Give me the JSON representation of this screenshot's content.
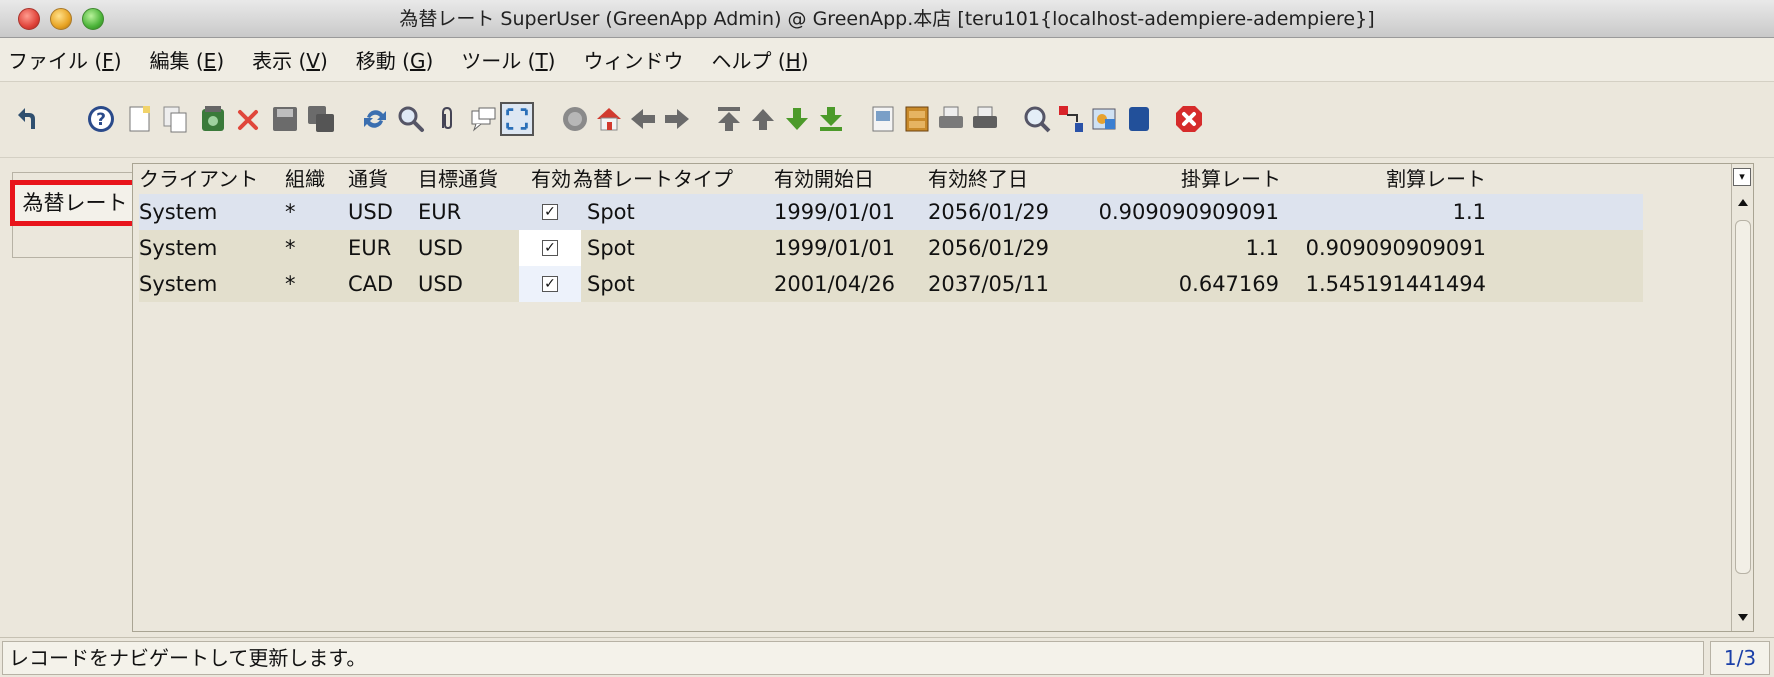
{
  "window": {
    "title": "為替レート  SuperUser (GreenApp Admin) @ GreenApp.本店 [teru101{localhost-adempiere-adempiere}]"
  },
  "menu": [
    {
      "label": "ファイル (",
      "mnemonic": "F",
      "tail": ")"
    },
    {
      "label": "編集 (",
      "mnemonic": "E",
      "tail": ")"
    },
    {
      "label": "表示 (",
      "mnemonic": "V",
      "tail": ")"
    },
    {
      "label": "移動 (",
      "mnemonic": "G",
      "tail": ")"
    },
    {
      "label": "ツール (",
      "mnemonic": "T",
      "tail": ")"
    },
    {
      "label": "ウィンドウ",
      "mnemonic": "",
      "tail": ""
    },
    {
      "label": "ヘルプ (",
      "mnemonic": "H",
      "tail": ")"
    }
  ],
  "toolbar_icons": [
    "undo-icon",
    "help-icon",
    "new-record-icon",
    "copy-record-icon",
    "save-grid-icon",
    "delete-icon",
    "save-icon",
    "save-multi-icon",
    "refresh-icon",
    "find-icon",
    "attachment-icon",
    "chat-icon",
    "toggle-grid-icon",
    "history-icon",
    "home-icon",
    "back-icon",
    "forward-icon",
    "first-record-icon",
    "previous-record-icon",
    "next-record-icon",
    "last-record-icon",
    "report-icon",
    "archive-icon",
    "print-preview-icon",
    "print-icon",
    "zoom-across-icon",
    "product-info-icon",
    "workflow-icon",
    "request-icon",
    "close-window-icon"
  ],
  "tab": {
    "label": "為替レート"
  },
  "grid": {
    "columns": [
      "クライアント",
      "組織",
      "通貨",
      "目標通貨",
      "有効",
      "為替レートタイプ",
      "有効開始日",
      "有効終了日",
      "掛算レート",
      "割算レート"
    ],
    "rows": [
      {
        "client": "System",
        "org": "*",
        "currency": "USD",
        "target": "EUR",
        "active": true,
        "type": "Spot",
        "from": "1999/01/01",
        "to": "2056/01/29",
        "multiply": "0.909090909091",
        "divide": "1.1"
      },
      {
        "client": "System",
        "org": "*",
        "currency": "EUR",
        "target": "USD",
        "active": true,
        "type": "Spot",
        "from": "1999/01/01",
        "to": "2056/01/29",
        "multiply": "1.1",
        "divide": "0.909090909091"
      },
      {
        "client": "System",
        "org": "*",
        "currency": "CAD",
        "target": "USD",
        "active": true,
        "type": "Spot",
        "from": "2001/04/26",
        "to": "2037/05/11",
        "multiply": "0.647169",
        "divide": "1.545191441494"
      }
    ]
  },
  "status": {
    "message": "レコードをナビゲートして更新します。",
    "record_count": "1/3"
  },
  "colors": {
    "highlight_border": "#e8141b",
    "selected_row": "#dde3ee",
    "row_background": "#e3dfcd"
  }
}
